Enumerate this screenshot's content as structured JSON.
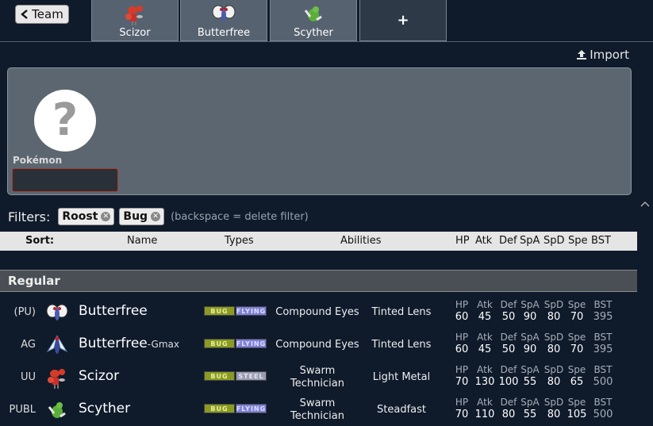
{
  "topbar": {
    "back_label": "Team",
    "tabs": [
      {
        "label": "Scizor",
        "icon": "scizor-sprite-icon"
      },
      {
        "label": "Butterfree",
        "icon": "butterfree-sprite-icon"
      },
      {
        "label": "Scyther",
        "icon": "scyther-sprite-icon"
      }
    ],
    "add_label": "+"
  },
  "import_label": "Import",
  "editor": {
    "placeholder_glyph": "?",
    "pokemon_label": "Pokémon",
    "pokemon_value": ""
  },
  "filters": {
    "title": "Filters:",
    "chips": [
      "Roost",
      "Bug"
    ],
    "hint": "(backspace = delete filter)"
  },
  "sort_header": {
    "sort": "Sort:",
    "name": "Name",
    "types": "Types",
    "abilities": "Abilities",
    "stats": [
      "HP",
      "Atk",
      "Def",
      "SpA",
      "SpD",
      "Spe",
      "BST"
    ]
  },
  "section_title": "Regular",
  "rows": [
    {
      "tier": "(PU)",
      "name": "Butterfree",
      "form": "",
      "types": [
        "BUG",
        "FLYING"
      ],
      "ability1": "Compound Eyes",
      "ability2": "Tinted Lens",
      "stats": [
        "60",
        "45",
        "50",
        "90",
        "80",
        "70",
        "395"
      ]
    },
    {
      "tier": "AG",
      "name": "Butterfree",
      "form": "-Gmax",
      "types": [
        "BUG",
        "FLYING"
      ],
      "ability1": "Compound Eyes",
      "ability2": "Tinted Lens",
      "stats": [
        "60",
        "45",
        "50",
        "90",
        "80",
        "70",
        "395"
      ]
    },
    {
      "tier": "UU",
      "name": "Scizor",
      "form": "",
      "types": [
        "BUG",
        "STEEL"
      ],
      "ability1": "Swarm\nTechnician",
      "ability2": "Light Metal",
      "stats": [
        "70",
        "130",
        "100",
        "55",
        "80",
        "65",
        "500"
      ]
    },
    {
      "tier": "PUBL",
      "name": "Scyther",
      "form": "",
      "types": [
        "BUG",
        "FLYING"
      ],
      "ability1": "Swarm\nTechnician",
      "ability2": "Steadfast",
      "stats": [
        "70",
        "110",
        "80",
        "55",
        "80",
        "105",
        "500"
      ]
    }
  ],
  "colors": {
    "background": "#0f1a2b",
    "panel": "#5c6670",
    "input_border": "#b23a2a",
    "bug": "#8a9a22",
    "flying": "#7d7fd6",
    "steel": "#9a9ab0"
  }
}
